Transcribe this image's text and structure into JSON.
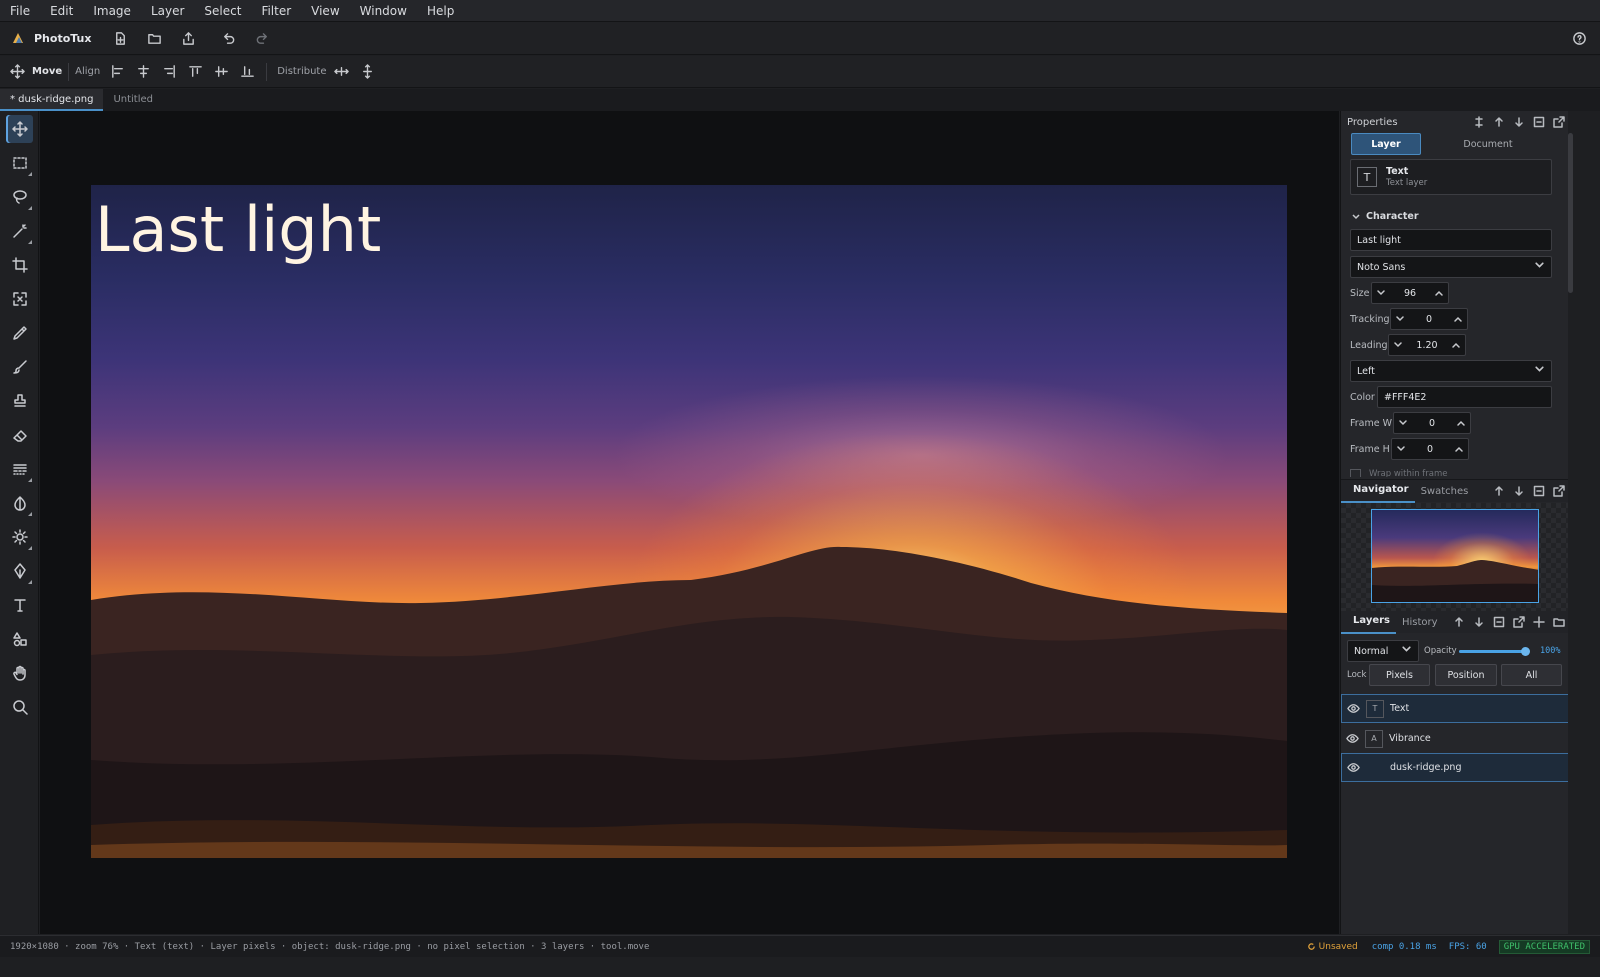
{
  "menu": [
    "File",
    "Edit",
    "Image",
    "Layer",
    "Select",
    "Filter",
    "View",
    "Window",
    "Help"
  ],
  "app": {
    "name": "PhotoTux"
  },
  "options": {
    "move_label": "Move",
    "align_label": "Align",
    "distribute_label": "Distribute"
  },
  "tabs": [
    {
      "label": "* dusk-ridge.png"
    },
    {
      "label": "Untitled"
    }
  ],
  "canvas": {
    "text": "Last light"
  },
  "properties": {
    "title": "Properties",
    "tab_layer": "Layer",
    "tab_document": "Document",
    "layer_kind_icon": "T",
    "layer_kind_title": "Text",
    "layer_kind_sub": "Text layer",
    "section": "Character",
    "text_value": "Last light",
    "font": "Noto Sans",
    "size_label": "Size",
    "size_value": "96",
    "tracking_label": "Tracking",
    "tracking_value": "0",
    "leading_label": "Leading",
    "leading_value": "1.20",
    "align_value": "Left",
    "color_label": "Color",
    "color_value": "#FFF4E2",
    "framew_label": "Frame W",
    "framew_value": "0",
    "frameh_label": "Frame H",
    "frameh_value": "0",
    "wrap_label": "Wrap within frame"
  },
  "navigator": {
    "tab_navigator": "Navigator",
    "tab_swatches": "Swatches"
  },
  "layers_panel": {
    "tab_layers": "Layers",
    "tab_history": "History",
    "blend": "Normal",
    "opacity_label": "Opacity",
    "opacity_value": "100%",
    "opacity": 1.0,
    "lock_label": "Lock",
    "lock_pixels": "Pixels",
    "lock_position": "Position",
    "lock_all": "All",
    "items": [
      {
        "icon": "T",
        "name": "Text"
      },
      {
        "icon": "A",
        "name": "Vibrance"
      },
      {
        "icon": "",
        "name": "dusk-ridge.png"
      }
    ]
  },
  "status": {
    "info": "1920×1080 · zoom 76% · Text (text) · Layer pixels · object: dusk-ridge.png · no pixel selection · 3 layers · tool.move",
    "unsaved": "Unsaved",
    "comp": "comp 0.18 ms",
    "fps": "FPS: 60",
    "gpu": "GPU ACCELERATED"
  },
  "colors": {
    "accent": "#4a90c8",
    "unsaved": "#e0a13a",
    "gpu": "#3fbf6a",
    "text_color": "#FFF4E2"
  }
}
